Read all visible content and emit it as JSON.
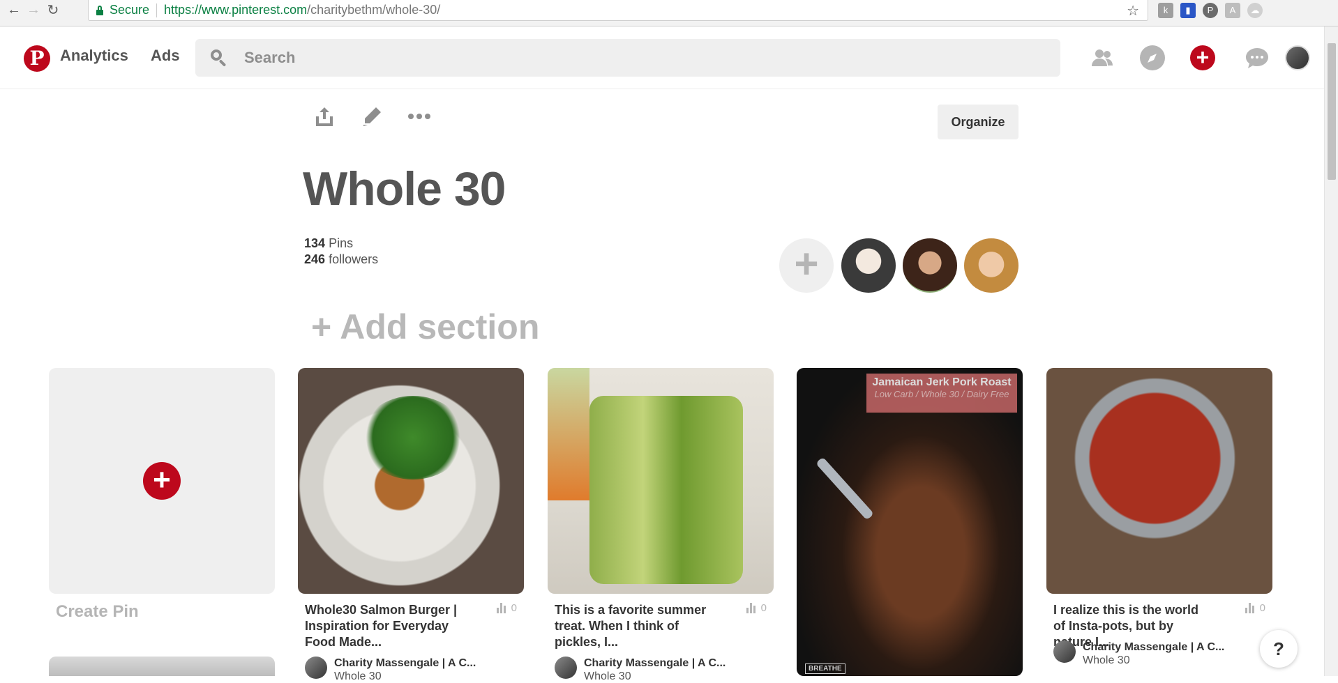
{
  "browser": {
    "secure_label": "Secure",
    "url_host": "https://www.pinterest.com",
    "url_path": "/charitybethm/whole-30/"
  },
  "header": {
    "nav": [
      "Analytics",
      "Ads"
    ],
    "search_placeholder": "Search",
    "logo_letter": "P"
  },
  "board": {
    "organize_label": "Organize",
    "title": "Whole 30",
    "pins_count": "134",
    "pins_label": "Pins",
    "followers_count": "246",
    "followers_label": "followers",
    "add_section_label": "Add section"
  },
  "create_pin": {
    "label": "Create Pin"
  },
  "pins": [
    {
      "description": "Whole30 Salmon Burger | Inspiration for Everyday Food Made...",
      "saves": "0",
      "pinner_name": "Charity Massengale | A C...",
      "board_name": "Whole 30"
    },
    {
      "description": "This is a favorite summer treat. When I think of pickles, I...",
      "saves": "0",
      "pinner_name": "Charity Massengale | A C...",
      "board_name": "Whole 30"
    },
    {
      "overlay_title": "Jamaican Jerk Pork Roast",
      "overlay_subtitle": "Low Carb / Whole 30 / Dairy Free",
      "overlay_badge": "BREATHE"
    },
    {
      "description": "I realize this is the world of Insta-pots, but by nature I...",
      "saves": "0",
      "pinner_name": "Charity Massengale | A C...",
      "board_name": "Whole 30"
    }
  ],
  "help_label": "?",
  "colors": {
    "brand_red": "#bd081c",
    "secure_green": "#0b8043"
  }
}
